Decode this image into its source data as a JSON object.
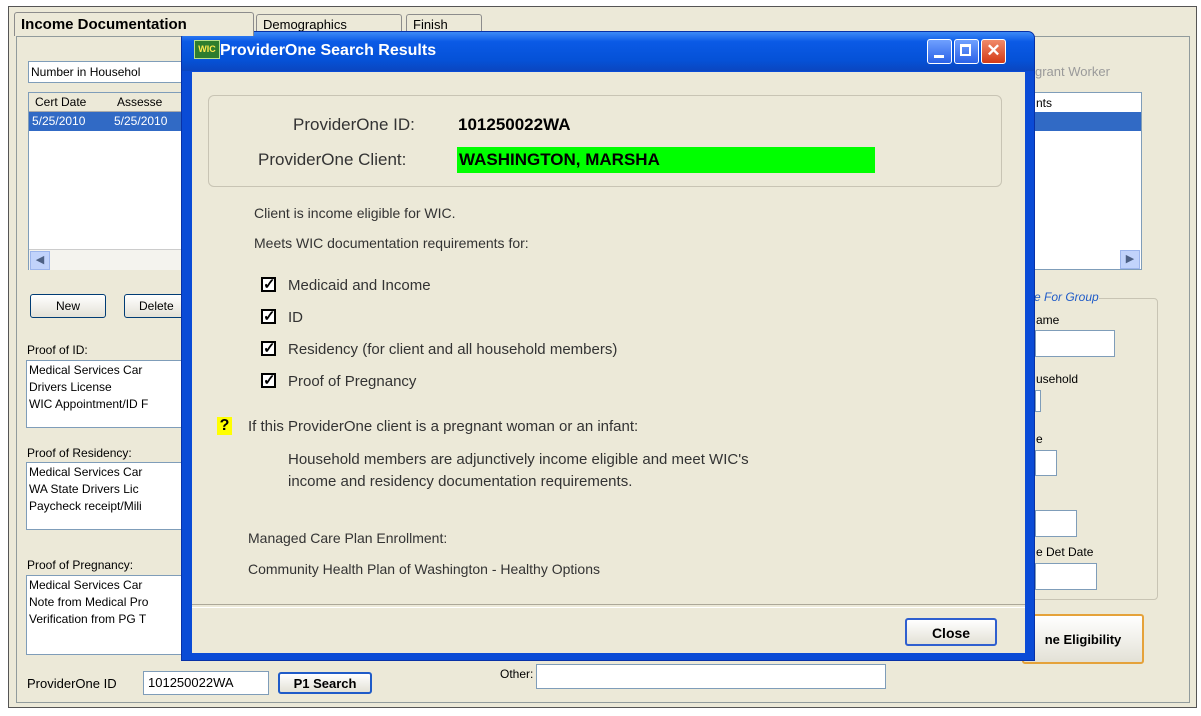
{
  "background": {
    "tabs": [
      "Income Documentation",
      "Demographics",
      "Finish"
    ],
    "household_label": "Number in Househol",
    "migrant_label": "grant Worker",
    "table_headers": [
      "Cert Date",
      "Assesse"
    ],
    "table_row": [
      "5/25/2010",
      "5/25/2010"
    ],
    "right_header": "nts",
    "new_button": "New",
    "delete_button": "Delete",
    "group_label": "e For Group",
    "name_label": "ame",
    "household_label2": "usehold",
    "e_label": "e",
    "det_date_label": "e Det Date",
    "eligibility_button": "ne Eligibility",
    "proof_id_label": "Proof of ID:",
    "proof_id_items": [
      "Medical Services Car",
      "Drivers License",
      "WIC Appointment/ID F"
    ],
    "proof_res_label": "Proof of Residency:",
    "proof_res_items": [
      "Medical Services Car",
      "WA State Drivers Lic",
      "Paycheck receipt/Mili"
    ],
    "proof_preg_label": "Proof of Pregnancy:",
    "proof_preg_items": [
      "Medical Services Car",
      "Note from Medical Pro",
      "Verification from PG T"
    ],
    "providerone_id_label": "ProviderOne ID",
    "providerone_id_value": "101250022WA",
    "p1_search_button": "P1 Search",
    "other_label": "Other:"
  },
  "dialog": {
    "icon_text": "WIC",
    "title": "ProviderOne Search Results",
    "id_label": "ProviderOne ID:",
    "id_value": "101250022WA",
    "client_label": "ProviderOne Client:",
    "client_value": "WASHINGTON, MARSHA",
    "eligible_text": "Client is income eligible for WIC.",
    "meets_text": "Meets WIC documentation requirements for:",
    "checks": [
      "Medicaid and Income",
      "ID",
      "Residency (for client and all household members)",
      "Proof of Pregnancy"
    ],
    "help_icon_text": "?",
    "pregnant_text": "If this ProviderOne client is a pregnant woman or an infant:",
    "household_text_1": "Household members are adjunctively income eligible and meet WIC's",
    "household_text_2": "income and residency documentation requirements.",
    "managed_care_label": "Managed Care Plan Enrollment:",
    "managed_care_value": "Community Health Plan of Washington - Healthy Options",
    "close_button": "Close",
    "highlight_color": "#00ff00",
    "help_color": "#ffff00"
  }
}
